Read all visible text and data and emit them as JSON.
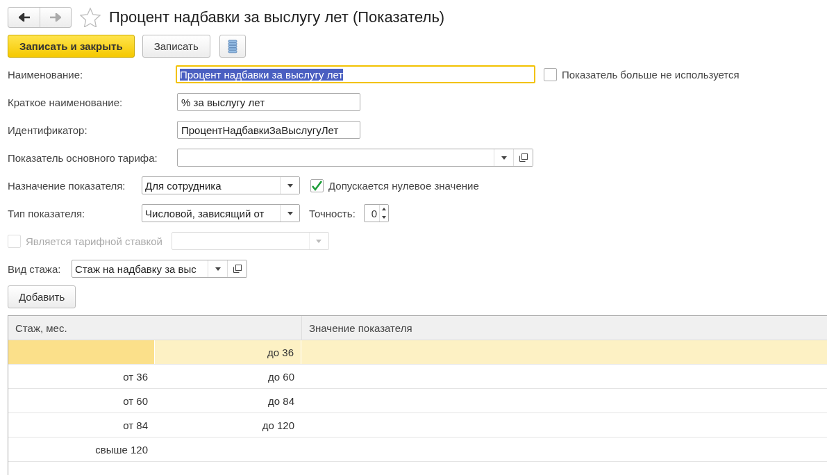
{
  "window": {
    "title": "Процент надбавки за выслугу лет (Показатель)",
    "favorite": false
  },
  "toolbar": {
    "buttons": [
      {
        "label": "Записать и закрыть",
        "kind": "primary"
      },
      {
        "label": "Записать",
        "kind": "normal"
      }
    ]
  },
  "form": {
    "name": {
      "label": "Наименование:",
      "value": "Процент надбавки за выслугу лет",
      "focused": true
    },
    "unused": {
      "label": "Показатель больше не используется",
      "checked": false
    },
    "short_name": {
      "label": "Краткое наименование:",
      "value": "% за выслугу лет"
    },
    "identifier": {
      "label": "Идентификатор:",
      "value": "ПроцентНадбавкиЗаВыслугуЛет"
    },
    "base_tariff": {
      "label": "Показатель основного тарифа:"
    },
    "purpose": {
      "label": "Назначение показателя:",
      "value": "Для сотрудника"
    },
    "allow_zero": {
      "label": "Допускается нулевое значение",
      "checked": true
    },
    "type": {
      "label": "Тип показателя:",
      "value": "Числовой, зависящий от"
    },
    "precision": {
      "label": "Точность:",
      "value": "0"
    },
    "tariff_rate": {
      "label": "Является тарифной ставкой",
      "checked": false,
      "disabled": true
    },
    "seniority_kind": {
      "label": "Вид стажа:",
      "value": "Стаж на надбавку за выс"
    },
    "add_button": "Добавить"
  },
  "table": {
    "columns": [
      "Стаж, мес.",
      "Значение показателя"
    ],
    "rows": [
      {
        "from": "",
        "to": "до 36",
        "selected": true
      },
      {
        "from": "от 36",
        "to": "до 60",
        "selected": false
      },
      {
        "from": "от 60",
        "to": "до 84",
        "selected": false
      },
      {
        "from": "от 84",
        "to": "до 120",
        "selected": false
      },
      {
        "from": "свыше 120",
        "to": "",
        "selected": false
      }
    ]
  }
}
